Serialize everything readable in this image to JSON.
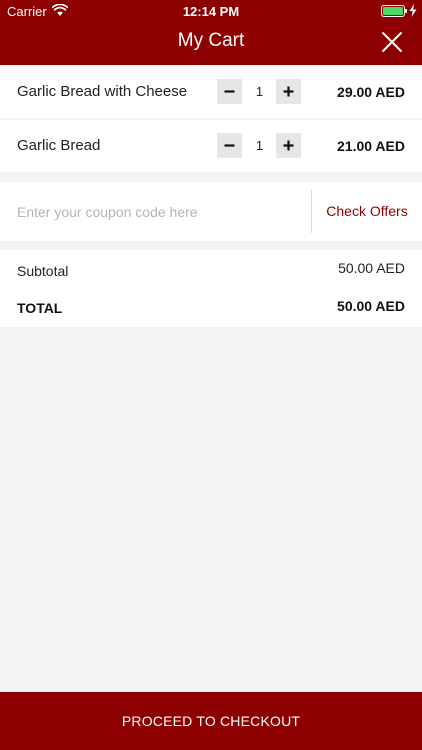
{
  "status_bar": {
    "carrier": "Carrier",
    "time": "12:14 PM",
    "battery_level": 1.0
  },
  "header": {
    "title": "My Cart"
  },
  "cart": {
    "items": [
      {
        "name": "Garlic Bread with Cheese",
        "quantity": "1",
        "price": "29.00 AED"
      },
      {
        "name": "Garlic Bread",
        "quantity": "1",
        "price": "21.00 AED"
      }
    ]
  },
  "coupon": {
    "placeholder": "Enter your coupon code here",
    "value": "",
    "check_offers_label": "Check Offers"
  },
  "summary": {
    "subtotal_label": "Subtotal",
    "subtotal_value": "50.00 AED",
    "total_label": "TOTAL",
    "total_value": "50.00 AED"
  },
  "checkout": {
    "label": "PROCEED TO CHECKOUT"
  },
  "colors": {
    "brand": "#8c0000",
    "background": "#f3f3f3",
    "battery": "#4cd964"
  }
}
